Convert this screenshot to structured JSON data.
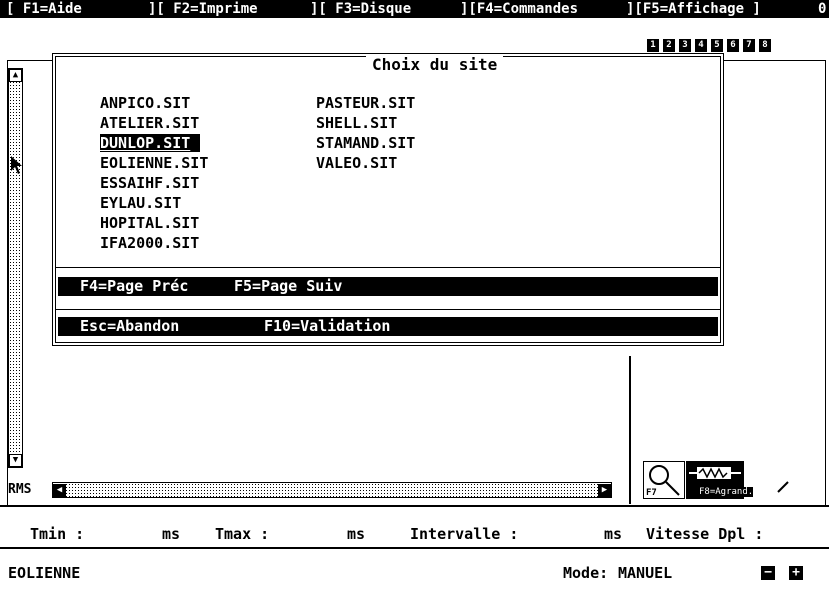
{
  "menu": {
    "items": [
      "[ F1=Aide",
      "][ F2=Imprime",
      "][ F3=Disque",
      "][F4=Commandes",
      "][F5=Affichage ]",
      "0"
    ]
  },
  "pages": [
    "1",
    "2",
    "3",
    "4",
    "5",
    "6",
    "7",
    "8"
  ],
  "dialog": {
    "title": "Choix du site",
    "col1": [
      "ANPICO.SIT",
      "ATELIER.SIT",
      "DUNLOP.SIT",
      "EOLIENNE.SIT",
      "ESSAIHF.SIT",
      "EYLAU.SIT",
      "HOPITAL.SIT",
      "IFA2000.SIT"
    ],
    "col2": [
      "PASTEUR.SIT",
      "SHELL.SIT",
      "STAMAND.SIT",
      "VALEO.SIT"
    ],
    "selected": "DUNLOP.SIT",
    "page_prev": "F4=Page Préc",
    "page_next": "F5=Page Suiv",
    "cancel": "Esc=Abandon",
    "validate": "F10=Validation"
  },
  "scroll": {
    "rms_label": "RMS"
  },
  "tools": {
    "zoom_label": "F7",
    "enlarge_label": "F8=Agrand."
  },
  "status": {
    "tmin_label": "Tmin :",
    "tmin_unit": "ms",
    "tmax_label": "Tmax :",
    "tmax_unit": "ms",
    "interval_label": "Intervalle :",
    "interval_unit": "ms",
    "speed_label": "Vitesse Dpl :"
  },
  "bottom": {
    "site_name": "EOLIENNE",
    "mode_label": "Mode:",
    "mode_value": "MANUEL",
    "minus": "−",
    "plus": "+"
  }
}
